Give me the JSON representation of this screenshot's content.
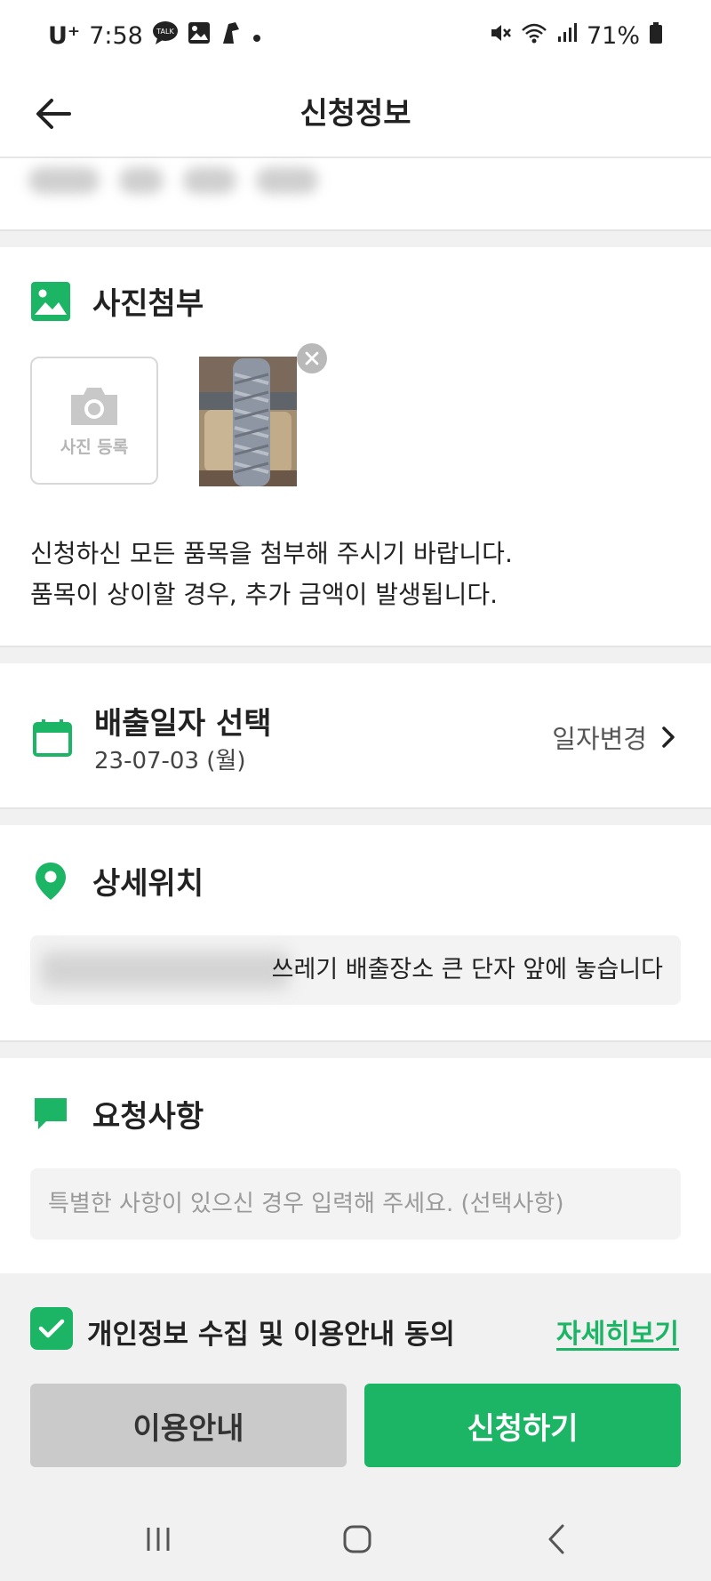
{
  "status_bar": {
    "carrier": "U⁺",
    "time": "7:58",
    "battery": "71%",
    "icons_left": [
      "talk-icon",
      "gallery-icon",
      "app-icon",
      "dot-icon"
    ],
    "icons_right": [
      "mute-icon",
      "wifi-icon",
      "signal-icon",
      "battery-icon"
    ]
  },
  "header": {
    "title": "신청정보"
  },
  "photo_section": {
    "title": "사진첨부",
    "register_label": "사진 등록",
    "notice_line1": "신청하신 모든 품목을 첨부해 주시기 바랍니다.",
    "notice_line2": "품목이 상이할 경우, 추가 금액이 발생됩니다."
  },
  "date_section": {
    "title": "배출일자 선택",
    "value": "23-07-03 (월)",
    "change_label": "일자변경"
  },
  "location_section": {
    "title": "상세위치",
    "value": "쓰레기 배출장소 큰 단자 앞에 놓습니다"
  },
  "request_section": {
    "title": "요청사항",
    "placeholder": "특별한 사항이 있으신 경우 입력해 주세요. (선택사항)",
    "value": ""
  },
  "consent": {
    "label": "개인정보 수집 및 이용안내 동의",
    "checked": true,
    "detail_link": "자세히보기"
  },
  "buttons": {
    "guide": "이용안내",
    "apply": "신청하기"
  },
  "colors": {
    "accent": "#1cb465",
    "divider": "#f1f1f1",
    "input_bg": "#f3f3f3",
    "secondary_button": "#cacaca"
  }
}
